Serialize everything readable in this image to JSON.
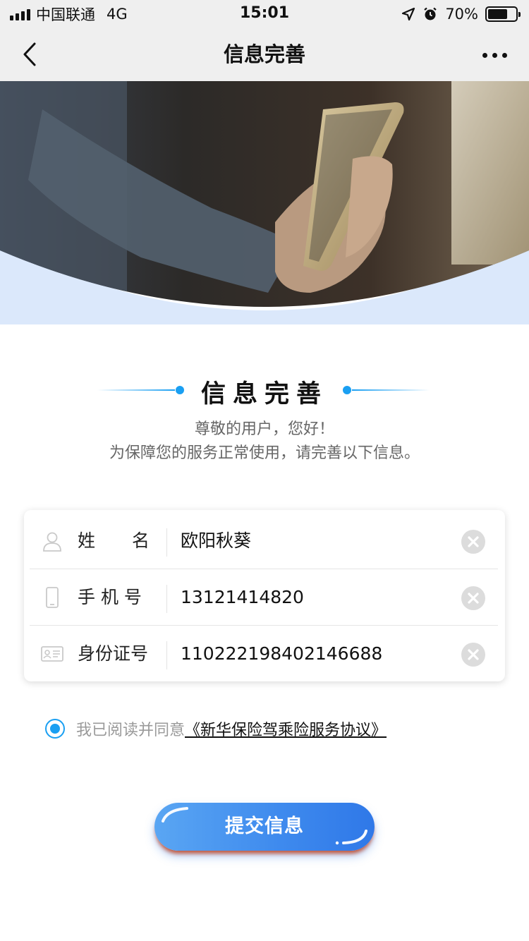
{
  "status_bar": {
    "carrier": "中国联通",
    "network": "4G",
    "time": "15:01",
    "battery": "70%",
    "battery_level": 0.7
  },
  "nav": {
    "title": "信息完善",
    "back_icon": "chevron-left-icon",
    "more_icon": "more-dots-icon"
  },
  "section": {
    "title": "信息完善",
    "greeting": "尊敬的用户，您好！",
    "instruction": "为保障您的服务正常使用，请完善以下信息。"
  },
  "form": {
    "fields": [
      {
        "label": "姓 名",
        "value": "欧阳秋葵",
        "icon": "person-icon"
      },
      {
        "label": "手 机 号",
        "value": "13121414820",
        "icon": "phone-icon"
      },
      {
        "label": "身份证号",
        "value": "110222198402146688",
        "icon": "id-card-icon"
      }
    ]
  },
  "agreement": {
    "text": "我已阅读并同意",
    "link": "《新华保险驾乘险服务协议》",
    "checked": true
  },
  "submit": {
    "label": "提交信息"
  },
  "colors": {
    "accent": "#1a9ff2",
    "button_start": "#5aa6f3",
    "button_end": "#2f78e8",
    "banner_arc": "#dbe8fb"
  }
}
